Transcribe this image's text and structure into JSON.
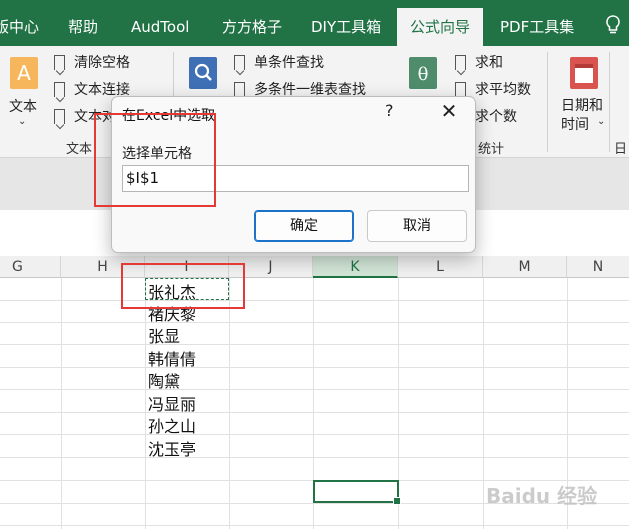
{
  "tabs": [
    {
      "label": "版中心",
      "active": false
    },
    {
      "label": "帮助",
      "active": false
    },
    {
      "label": "AudTool",
      "active": false
    },
    {
      "label": "方方格子",
      "active": false
    },
    {
      "label": "DIY工具箱",
      "active": false
    },
    {
      "label": "公式向导",
      "active": true
    },
    {
      "label": "PDF工具集",
      "active": false
    }
  ],
  "ribbon": {
    "text_group": {
      "big_button": "文本",
      "items": [
        "清除空格",
        "文本连接",
        "文本对"
      ],
      "group_label": "文本"
    },
    "lookup_group": {
      "items": [
        "单条件查找",
        "多条件一维表查找"
      ]
    },
    "stats_group": {
      "items": [
        "求和",
        "求平均数",
        "求个数"
      ],
      "group_label": "统计"
    },
    "date_group": {
      "big_button_line1": "日期和",
      "big_button_line2": "时间",
      "group_label": "日"
    }
  },
  "dialog": {
    "title": "在Excel中选取",
    "help": "?",
    "close": "✕",
    "field_label": "选择单元格",
    "field_value": "$I$1",
    "ok": "确定",
    "cancel": "取消"
  },
  "columns": [
    "G",
    "H",
    "I",
    "J",
    "K",
    "L",
    "M",
    "N"
  ],
  "selected_column": "K",
  "names": [
    "张礼杰",
    "褚庆黎",
    "张显",
    "韩倩倩",
    "陶黛",
    "冯显丽",
    "孙之山",
    "沈玉亭"
  ],
  "watermark": "Baidu 经验",
  "colors": {
    "excel_green": "#217346",
    "annotation_red": "#e53935",
    "primary_button_border": "#1a73c9"
  }
}
